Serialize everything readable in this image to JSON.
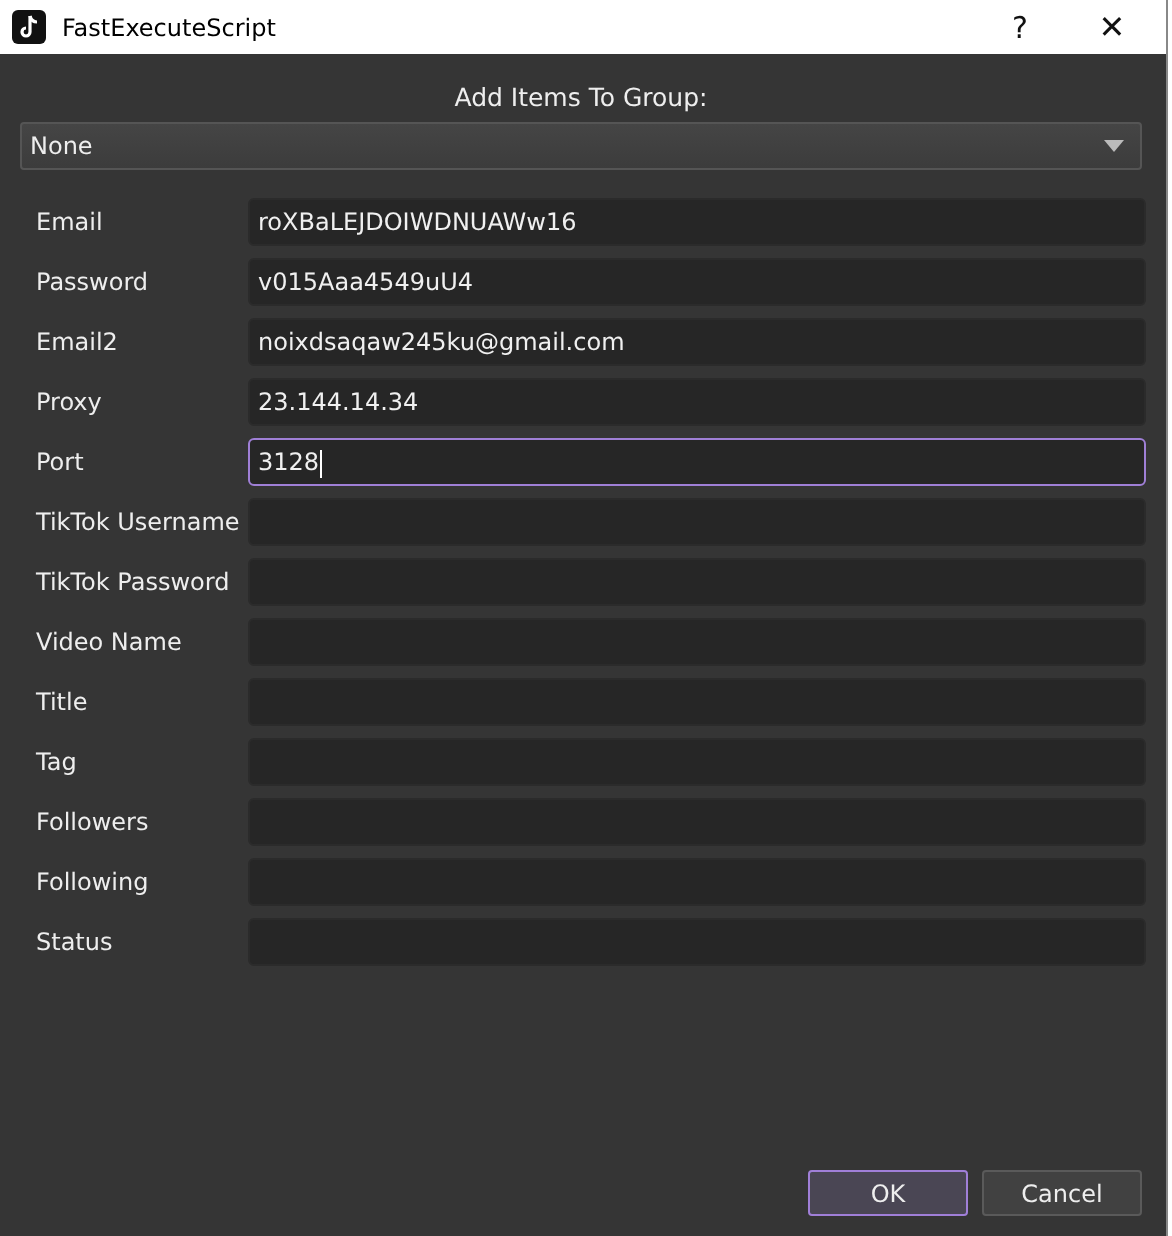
{
  "window": {
    "title": "FastExecuteScript",
    "buttons": [
      "?",
      "✕"
    ]
  },
  "group": {
    "label": "Add Items To Group:",
    "value": "None"
  },
  "fields": [
    {
      "label": "Email",
      "value": "roXBaLEJDOIWDNUAWw16",
      "focused": false
    },
    {
      "label": "Password",
      "value": "v015Aaa4549uU4",
      "focused": false
    },
    {
      "label": "Email2",
      "value": "noixdsaqaw245ku@gmail.com",
      "focused": false
    },
    {
      "label": "Proxy",
      "value": "23.144.14.34",
      "focused": false
    },
    {
      "label": "Port",
      "value": "3128",
      "focused": true
    },
    {
      "label": "TikTok Username",
      "focused": false
    },
    {
      "label": "TikTok Password",
      "focused": false
    },
    {
      "label": "Video Name",
      "focused": false
    },
    {
      "label": "Title",
      "focused": false
    },
    {
      "label": "Tag",
      "focused": false
    },
    {
      "label": "Followers",
      "focused": false
    },
    {
      "label": "Following",
      "focused": false
    },
    {
      "label": "Status",
      "focused": false
    }
  ],
  "buttons": [
    {
      "label": "OK",
      "default": true
    },
    {
      "label": "Cancel",
      "default": false
    }
  ]
}
